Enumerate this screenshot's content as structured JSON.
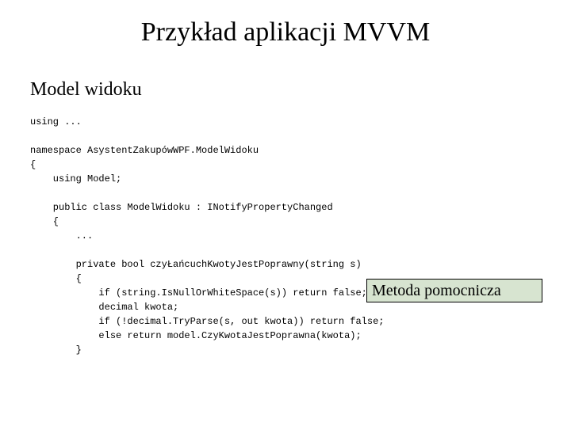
{
  "title": "Przykład aplikacji MVVM",
  "subtitle": "Model widoku",
  "callout": "Metoda pomocnicza",
  "code": {
    "l01": "using ...",
    "l02": "",
    "l03": "namespace AsystentZakupówWPF.ModelWidoku",
    "l04": "{",
    "l05": "    using Model;",
    "l06": "",
    "l07": "    public class ModelWidoku : INotifyPropertyChanged",
    "l08": "    {",
    "l09": "        ...",
    "l10": "",
    "l11": "        private bool czyŁańcuchKwotyJestPoprawny(string s)",
    "l12": "        {",
    "l13": "            if (string.IsNullOrWhiteSpace(s)) return false;",
    "l14": "            decimal kwota;",
    "l15": "            if (!decimal.TryParse(s, out kwota)) return false;",
    "l16": "            else return model.CzyKwotaJestPoprawna(kwota);",
    "l17": "        }"
  }
}
